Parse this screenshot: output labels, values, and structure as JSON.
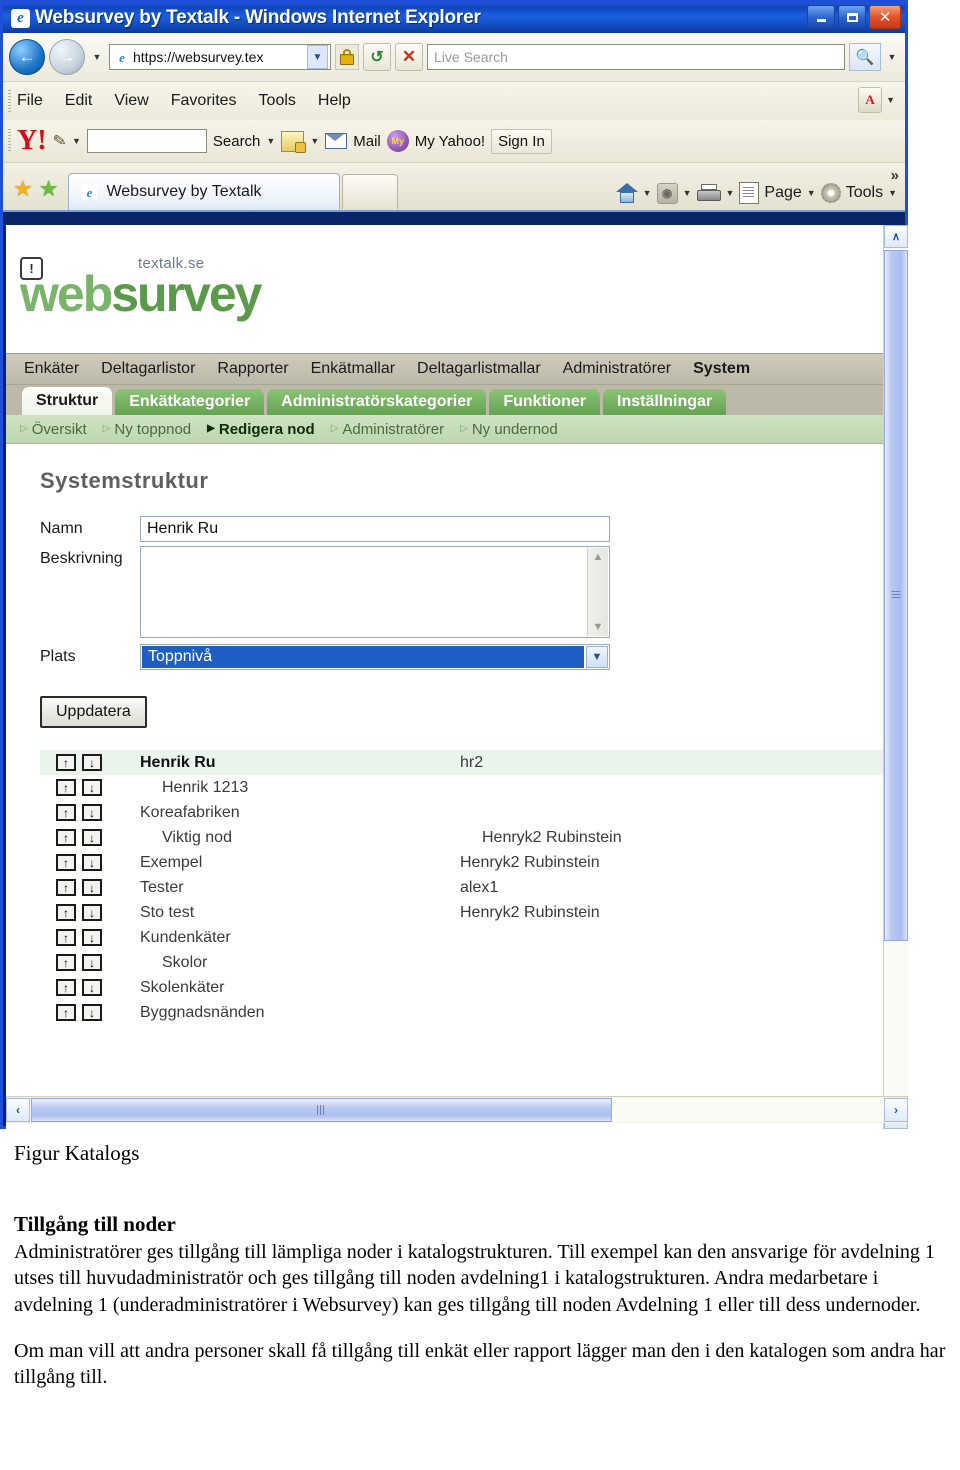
{
  "window": {
    "title": "Websurvey by Textalk - Windows Internet Explorer",
    "icon": "ie-icon",
    "minimize_label": "Minimize",
    "maximize_label": "Maximize",
    "close_label": "Close"
  },
  "addressbar": {
    "back_label": "Back",
    "forward_label": "Forward",
    "url": "https://websurvey.tex",
    "lock_label": "Secure",
    "refresh_label": "Refresh",
    "stop_label": "Stop",
    "search_placeholder": "Live Search",
    "search_label": "Search"
  },
  "menubar": {
    "items": [
      "File",
      "Edit",
      "View",
      "Favorites",
      "Tools",
      "Help"
    ]
  },
  "yahoo_toolbar": {
    "logo": "Y!",
    "search_value": "",
    "search_button": "Search",
    "mail_label": "Mail",
    "my_yahoo_label": "My Yahoo!",
    "signin_label": "Sign In"
  },
  "tabbar": {
    "favorites_label": "Favorites",
    "add_favorites_label": "Add to Favorites",
    "page_tab_label": "Websurvey by Textalk",
    "home_label": "Home",
    "feeds_label": "Feeds",
    "print_label": "Print",
    "page_label": "Page",
    "tools_label": "Tools",
    "overflow_label": "»"
  },
  "site": {
    "brand": "websurvey",
    "brand_prefix": "web",
    "brand_suffix": "survey",
    "tagline": "textalk.se",
    "info_glyph": "!"
  },
  "mainnav": {
    "items": [
      {
        "label": "Enkäter",
        "active": false
      },
      {
        "label": "Deltagarlistor",
        "active": false
      },
      {
        "label": "Rapporter",
        "active": false
      },
      {
        "label": "Enkätmallar",
        "active": false
      },
      {
        "label": "Deltagarlistmallar",
        "active": false
      },
      {
        "label": "Administratörer",
        "active": false
      },
      {
        "label": "System",
        "active": true
      }
    ]
  },
  "subtabs": {
    "items": [
      {
        "label": "Struktur",
        "active": true
      },
      {
        "label": "Enkätkategorier",
        "active": false
      },
      {
        "label": "Administratörskategorier",
        "active": false
      },
      {
        "label": "Funktioner",
        "active": false
      },
      {
        "label": "Inställningar",
        "active": false
      }
    ]
  },
  "subnav": {
    "items": [
      {
        "label": "Översikt",
        "active": false
      },
      {
        "label": "Ny toppnod",
        "active": false
      },
      {
        "label": "Redigera nod",
        "active": true
      },
      {
        "label": "Administratörer",
        "active": false
      },
      {
        "label": "Ny undernod",
        "active": false
      }
    ]
  },
  "form": {
    "heading": "Systemstruktur",
    "name_label": "Namn",
    "name_value": "Henrik Ru",
    "description_label": "Beskrivning",
    "description_value": "",
    "place_label": "Plats",
    "place_value": "Toppnivå",
    "submit_label": "Uppdatera"
  },
  "tree": {
    "move_up_label": "↑",
    "move_down_label": "↓",
    "rows": [
      {
        "name": "Henrik Ru",
        "admin": "hr2",
        "indent": 0,
        "bold": true,
        "highlight": true
      },
      {
        "name": "Henrik 1213",
        "admin": "",
        "indent": 1,
        "bold": false,
        "highlight": false
      },
      {
        "name": "Koreafabriken",
        "admin": "",
        "indent": 0,
        "bold": false,
        "highlight": false
      },
      {
        "name": "Viktig nod",
        "admin": "Henryk2 Rubinstein",
        "indent": 1,
        "bold": false,
        "highlight": false
      },
      {
        "name": "Exempel",
        "admin": "Henryk2 Rubinstein",
        "indent": 0,
        "bold": false,
        "highlight": false
      },
      {
        "name": "Tester",
        "admin": "alex1",
        "indent": 0,
        "bold": false,
        "highlight": false
      },
      {
        "name": "Sto test",
        "admin": "Henryk2 Rubinstein",
        "indent": 0,
        "bold": false,
        "highlight": false
      },
      {
        "name": "Kundenkäter",
        "admin": "",
        "indent": 0,
        "bold": false,
        "highlight": false
      },
      {
        "name": "Skolor",
        "admin": "",
        "indent": 1,
        "bold": false,
        "highlight": false
      },
      {
        "name": "Skolenkäter",
        "admin": "",
        "indent": 0,
        "bold": false,
        "highlight": false
      },
      {
        "name": "Byggnadsnänden",
        "admin": "",
        "indent": 0,
        "bold": false,
        "highlight": false
      }
    ]
  },
  "scrollbars": {
    "up_label": "∧",
    "down_label": "∨",
    "left_label": "‹",
    "right_label": "›"
  },
  "document": {
    "figure_caption": "Figur Katalogs",
    "heading": "Tillgång till noder",
    "paragraph1": "Administratörer ges tillgång till lämpliga noder i katalogstrukturen. Till exempel kan den ansvarige för avdelning 1 utses till huvudadministratör och ges tillgång till noden avdelning1 i katalogstrukturen. Andra medarbetare i avdelning 1 (underadministratörer i Websurvey) kan ges tillgång till noden Avdelning 1 eller till dess undernoder.",
    "paragraph2": "Om man vill att andra personer skall få tillgång till enkät eller rapport lägger man den i den katalogen som andra har tillgång till."
  },
  "colors": {
    "brand_green": "#5a9a4a",
    "tab_green": "#63a352",
    "subnav_green": "#bcd7ae",
    "title_blue": "#1450c4",
    "select_blue": "#1f5fc4"
  }
}
